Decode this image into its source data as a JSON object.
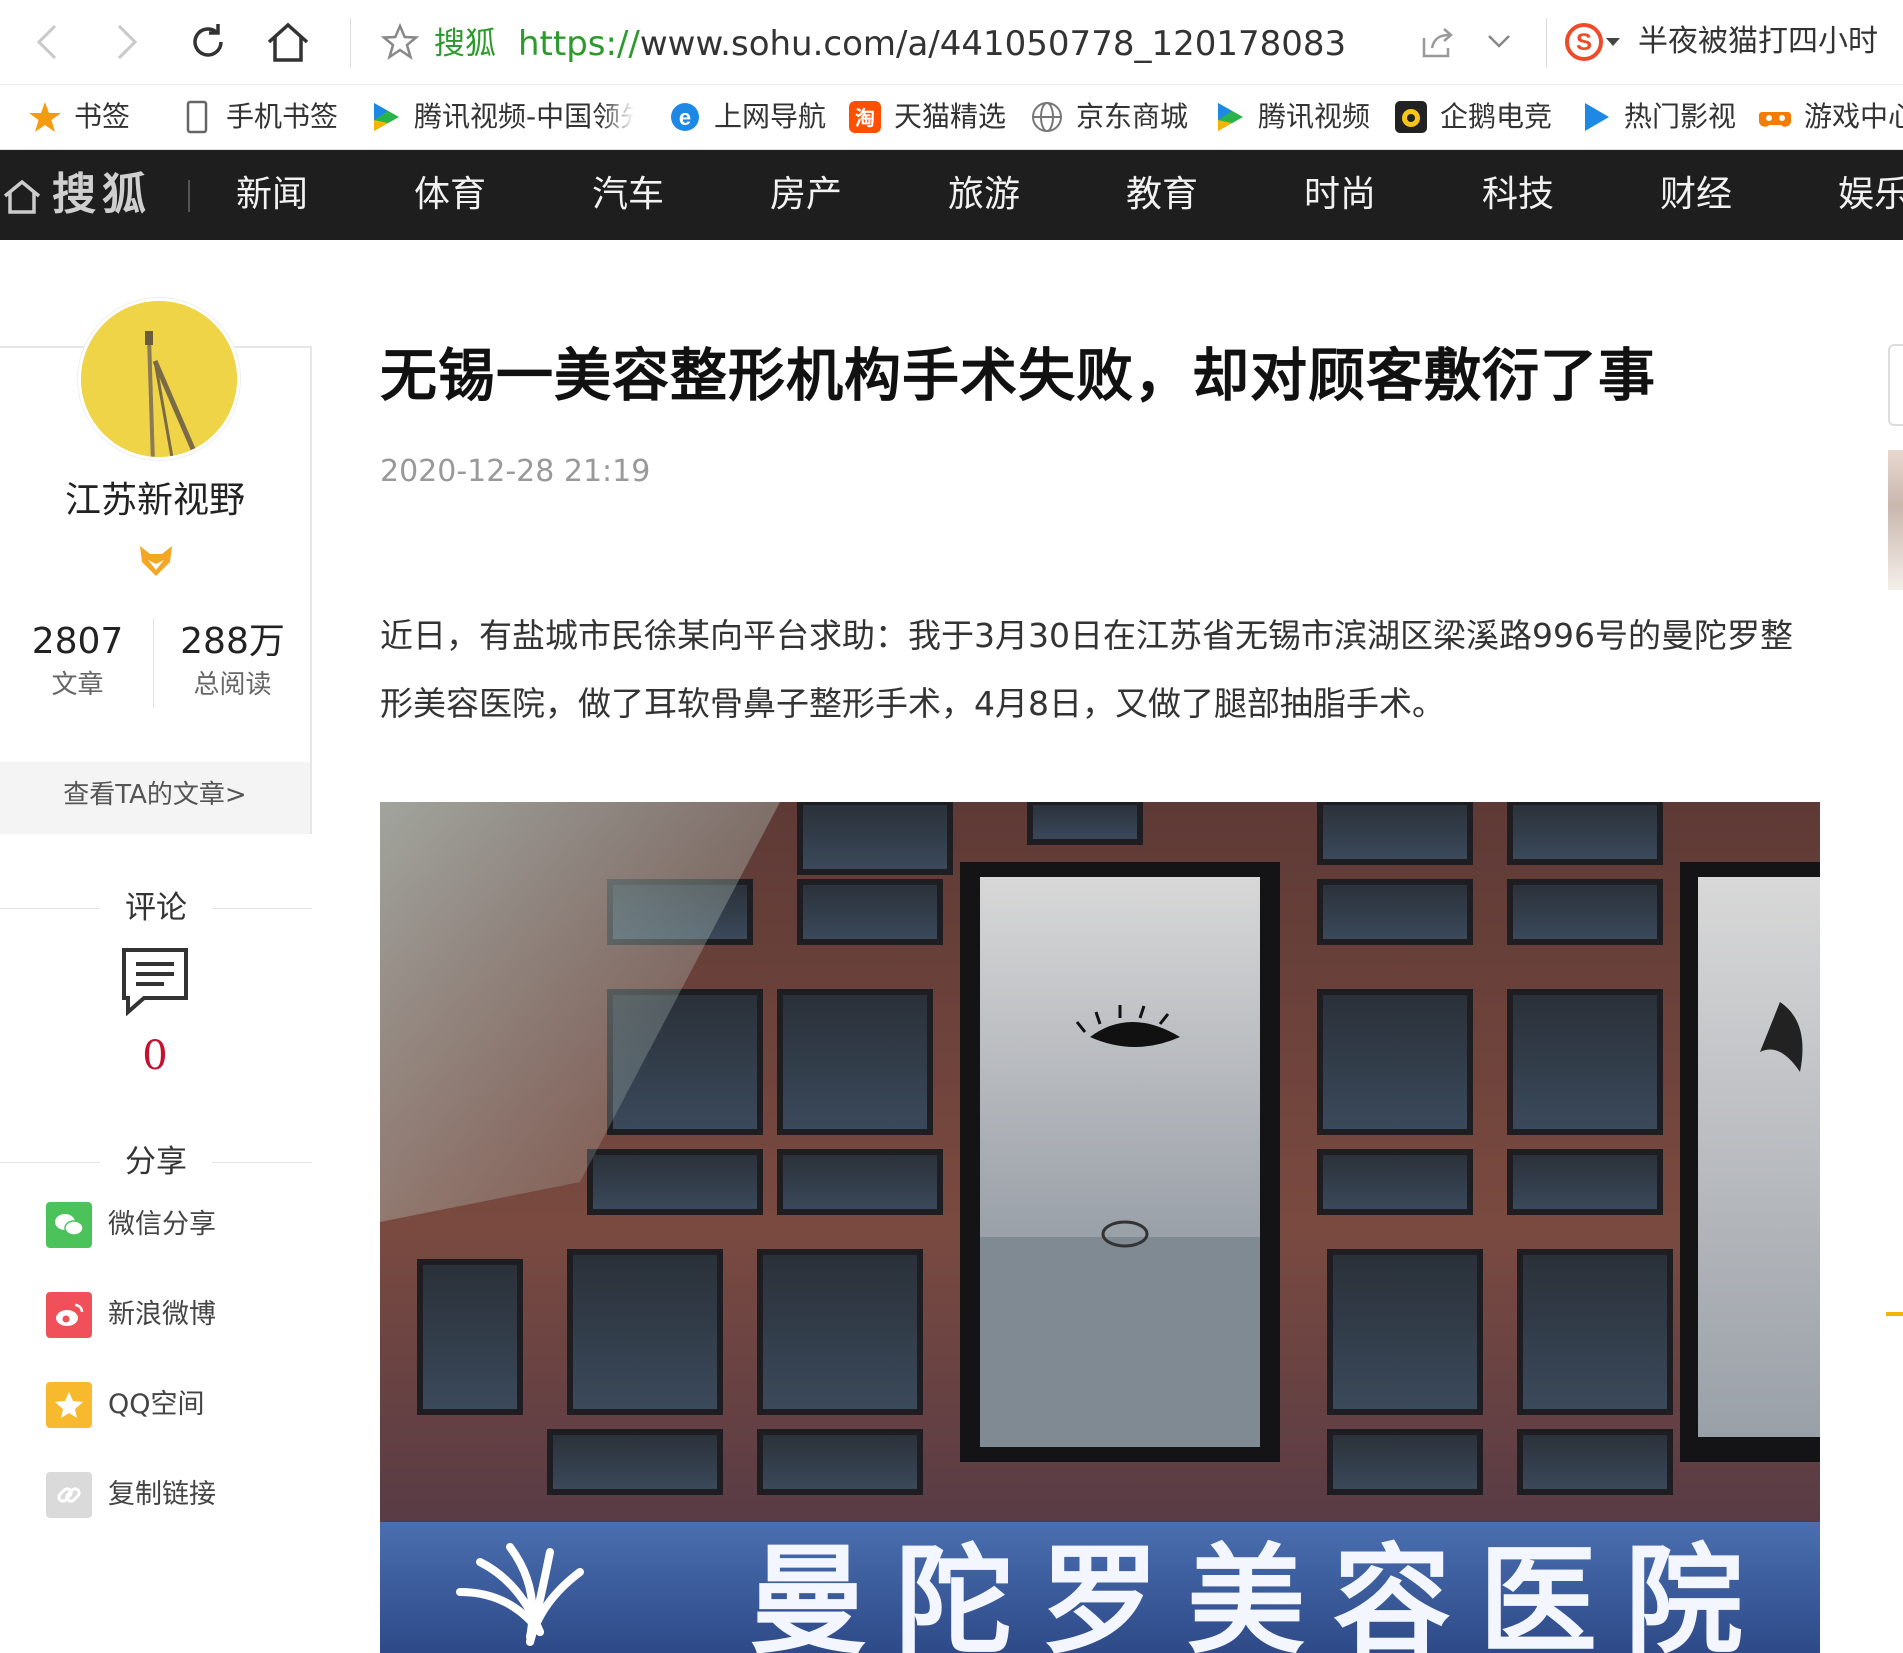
{
  "browser": {
    "url_site": "搜狐",
    "url_protocol": "https://",
    "url_rest": "www.sohu.com/a/441050778_120178083",
    "search_text": "半夜被猫打四小时"
  },
  "bookmarks": [
    {
      "label": "书签",
      "icon": "star-icon"
    },
    {
      "label": "手机书签",
      "icon": "phone-icon"
    },
    {
      "label": "腾讯视频-中国领先",
      "icon": "play-icon"
    },
    {
      "label": "上网导航",
      "icon": "ie-icon"
    },
    {
      "label": "天猫精选",
      "icon": "taobao-icon"
    },
    {
      "label": "京东商城",
      "icon": "globe-icon"
    },
    {
      "label": "腾讯视频",
      "icon": "play-icon"
    },
    {
      "label": "企鹅电竞",
      "icon": "esports-icon"
    },
    {
      "label": "热门影视",
      "icon": "play-icon"
    },
    {
      "label": "游戏中心",
      "icon": "gamepad-icon"
    }
  ],
  "sitenav": {
    "logo": "搜狐",
    "items": [
      "新闻",
      "体育",
      "汽车",
      "房产",
      "旅游",
      "教育",
      "时尚",
      "科技",
      "财经",
      "娱乐"
    ]
  },
  "author": {
    "name": "江苏新视野",
    "articles_count": "2807",
    "articles_label": "文章",
    "reads_count": "288万",
    "reads_label": "总阅读",
    "view_link": "查看TA的文章>"
  },
  "comments": {
    "title": "评论",
    "count": "0"
  },
  "share": {
    "title": "分享",
    "items": [
      {
        "label": "微信分享",
        "icon": "wechat-icon",
        "color": "#4cc25a"
      },
      {
        "label": "新浪微博",
        "icon": "weibo-icon",
        "color": "#f0505a"
      },
      {
        "label": "QQ空间",
        "icon": "qzone-icon",
        "color": "#f7b92d"
      },
      {
        "label": "复制链接",
        "icon": "link-icon",
        "color": "#d8d8d8"
      }
    ]
  },
  "article": {
    "title": "无锡一美容整形机构手术失败，却对顾客敷衍了事",
    "date": "2020-12-28 21:19",
    "paragraph": "近日，有盐城市民徐某向平台求助：我于3月30日在江苏省无锡市滨湖区梁溪路996号的曼陀罗整形美容医院，做了耳软骨鼻子整形手术，4月8日，又做了腿部抽脂手术。",
    "image_sign": "曼陀罗美容医院"
  },
  "colors": {
    "nav_bg": "#1e1e1e",
    "accent_green": "#2c9a2c",
    "comment_red": "#c8102e"
  }
}
